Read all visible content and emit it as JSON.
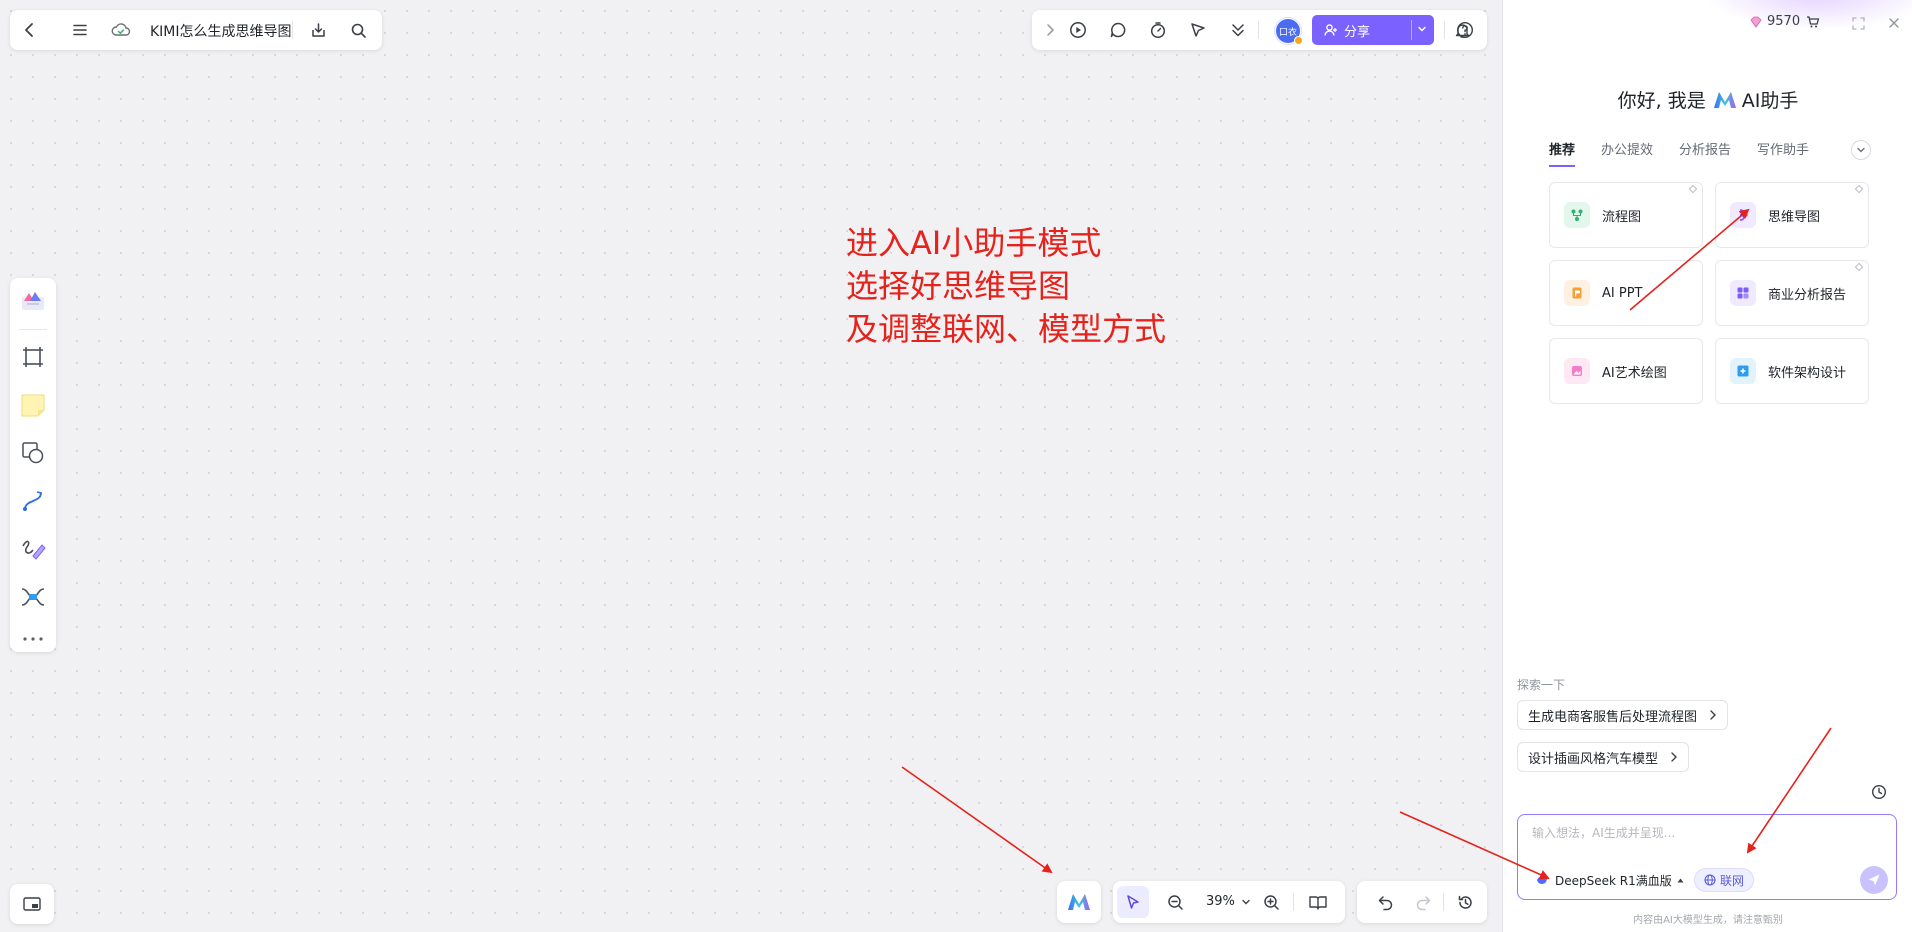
{
  "header": {
    "doc_title": "KIMI怎么生成思维导图"
  },
  "toolbar_right": {
    "avatar_text": "口衣",
    "share_label": "分享"
  },
  "annotation": {
    "line1": "进入AI小助手模式",
    "line2": "选择好思维导图",
    "line3": "及调整联网、模型方式"
  },
  "zoom": {
    "value": "39%"
  },
  "ai_panel": {
    "credits": "9570",
    "greeting_prefix": "你好, 我是",
    "greeting_suffix": "AI助手",
    "tabs": [
      "推荐",
      "办公提效",
      "分析报告",
      "写作助手"
    ],
    "cards": [
      {
        "label": "流程图",
        "icon": "flowchart-icon",
        "color": "#2db36f"
      },
      {
        "label": "思维导图",
        "icon": "mindmap-icon",
        "color": "#8a5cf6"
      },
      {
        "label": "AI PPT",
        "icon": "ppt-icon",
        "color": "#f59f3a"
      },
      {
        "label": "商业分析报告",
        "icon": "report-icon",
        "color": "#7c5cf5"
      },
      {
        "label": "AI艺术绘图",
        "icon": "art-icon",
        "color": "#e35db7"
      },
      {
        "label": "软件架构设计",
        "icon": "architecture-icon",
        "color": "#2f9cf0"
      }
    ],
    "explore_label": "探索一下",
    "suggestions": [
      "生成电商客服售后处理流程图",
      "设计插画风格汽车模型"
    ],
    "input_placeholder": "输入想法，AI生成并呈现...",
    "model": "DeepSeek R1满血版",
    "web_label": "联网",
    "disclaimer": "内容由AI大模型生成，请注意甄别"
  },
  "colors": {
    "accent": "#7b61ff",
    "annotation": "#e5231c"
  }
}
